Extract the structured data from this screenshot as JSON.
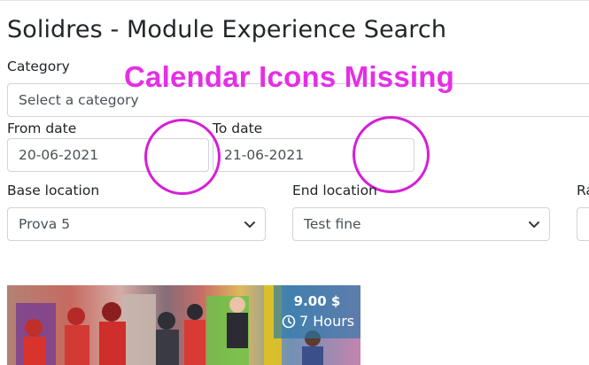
{
  "page": {
    "title": "Solidres - Module Experience Search"
  },
  "annotation": {
    "text": "Calendar Icons Missing",
    "color": "#e62ee6"
  },
  "form": {
    "category": {
      "label": "Category",
      "placeholder": "Select a category"
    },
    "from_date": {
      "label": "From date",
      "value": "20-06-2021"
    },
    "to_date": {
      "label": "To date",
      "value": "21-06-2021"
    },
    "base_location": {
      "label": "Base location",
      "value": "Prova 5"
    },
    "end_location": {
      "label": "End location",
      "value": "Test fine"
    },
    "third_column": {
      "label": "Ra"
    }
  },
  "result_card": {
    "price": "9.00 $",
    "duration": "7 Hours",
    "duration_icon": "clock-icon"
  }
}
